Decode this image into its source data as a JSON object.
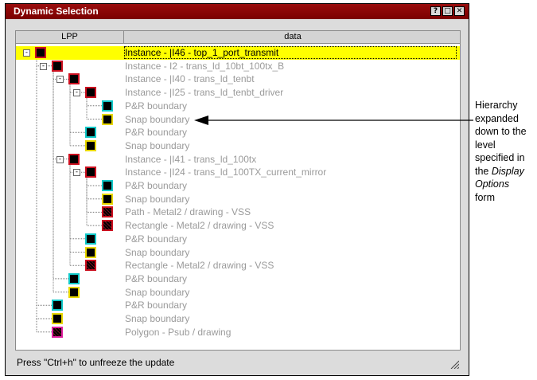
{
  "window": {
    "title": "Dynamic Selection",
    "buttons": [
      "?",
      "□",
      "✕"
    ]
  },
  "columns": {
    "lpp": "LPP",
    "data": "data"
  },
  "rows": [
    {
      "text": "Instance - |I46 - top_1_port_transmit",
      "selected": true
    },
    {
      "text": "Instance - I2 - trans_ld_10bt_100tx_B"
    },
    {
      "text": "Instance - |I40 - trans_ld_tenbt"
    },
    {
      "text": "Instance - |I25 - trans_ld_tenbt_driver"
    },
    {
      "text": "P&R boundary"
    },
    {
      "text": "Snap boundary"
    },
    {
      "text": "P&R boundary"
    },
    {
      "text": "Snap boundary"
    },
    {
      "text": "Instance - |I41 - trans_ld_100tx"
    },
    {
      "text": "Instance - |I24 - trans_ld_100TX_current_mirror"
    },
    {
      "text": "P&R boundary"
    },
    {
      "text": "Snap boundary"
    },
    {
      "text": "Path - Metal2 / drawing - VSS"
    },
    {
      "text": "Rectangle - Metal2 / drawing - VSS"
    },
    {
      "text": "P&R boundary"
    },
    {
      "text": "Snap boundary"
    },
    {
      "text": "Rectangle - Metal2 / drawing - VSS"
    },
    {
      "text": "P&R boundary"
    },
    {
      "text": "Snap boundary"
    },
    {
      "text": "P&R boundary"
    },
    {
      "text": "Snap boundary"
    },
    {
      "text": "Polygon - Psub / drawing"
    }
  ],
  "status": "Press \"Ctrl+h\" to unfreeze the update",
  "annotation": {
    "line1": "Hierarchy",
    "line2": "expanded",
    "line3": "down to the",
    "line4": "level",
    "line5": "specified in",
    "line6_prefix": "the ",
    "line6_italic": "Display",
    "line7_italic": "Options",
    "line8": "form"
  },
  "colors": {
    "title_bar": "#8b0000",
    "selection": "#ffff00",
    "swatch_red": "#cc1020",
    "swatch_yellow": "#e8d800",
    "swatch_cyan": "#10c8c8",
    "swatch_magenta": "#e020a0"
  }
}
